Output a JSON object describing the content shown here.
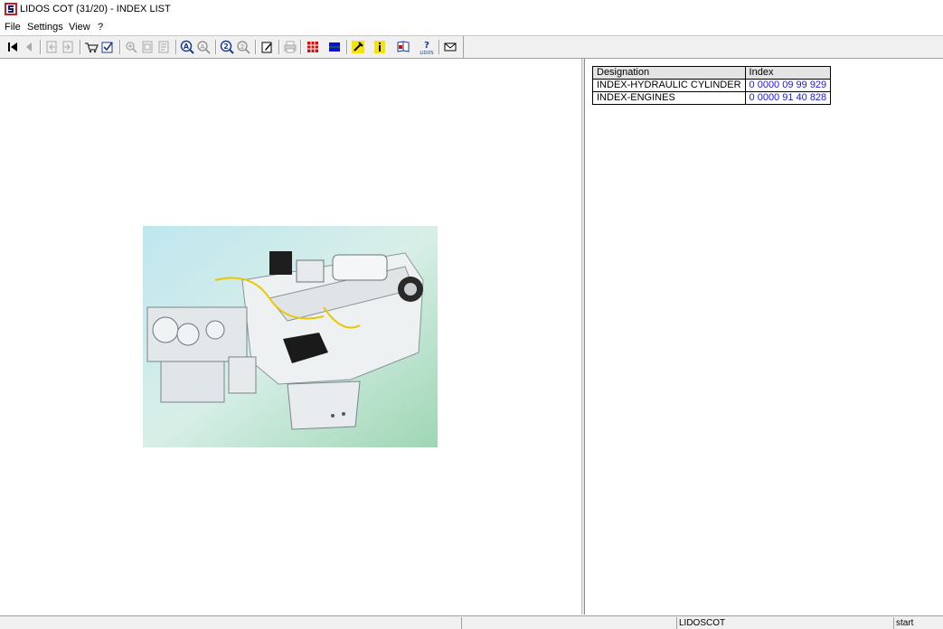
{
  "window": {
    "title": "LIDOS COT (31/20) - INDEX LIST",
    "app_icon": "lidos-app-icon"
  },
  "menu": [
    {
      "label": "File"
    },
    {
      "label": "Settings"
    },
    {
      "label": "View"
    },
    {
      "label": "?"
    }
  ],
  "toolbar": {
    "icons": [
      "first-page-icon",
      "previous-page-icon",
      "back-doc-icon",
      "forward-doc-icon",
      "cart-icon",
      "checklist-icon",
      "zoom-in-icon",
      "fit-page-icon",
      "page-view-icon",
      "search-a-icon",
      "search-a-next-icon",
      "search-2-icon",
      "search-2-next-icon",
      "edit-note-icon",
      "print-icon",
      "grid-table-icon",
      "blue-square-icon",
      "tools-icon",
      "info-icon",
      "book-icon",
      "lidos-help-icon",
      "mail-icon"
    ]
  },
  "image": {
    "name": "engine-image"
  },
  "index_table": {
    "headers": {
      "designation": "Designation",
      "index": "Index"
    },
    "rows": [
      {
        "designation": "INDEX-HYDRAULIC CYLINDER",
        "index": "0 0000 09 99 929"
      },
      {
        "designation": "INDEX-ENGINES",
        "index": "0 0000 91 40 828"
      }
    ],
    "link_color": "#1a1adc"
  },
  "statusbar": {
    "app": "LIDOSCOT",
    "state": "start"
  }
}
